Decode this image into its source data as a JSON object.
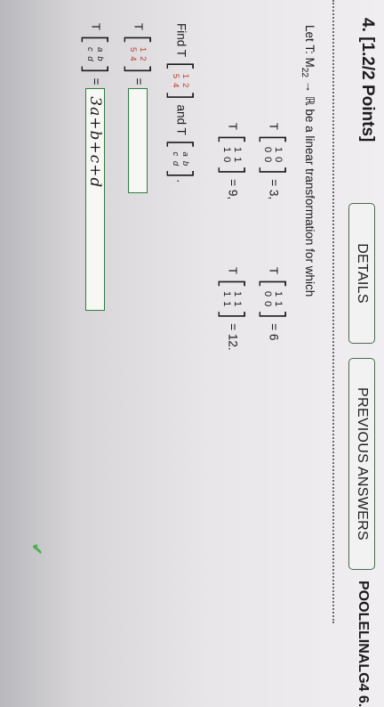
{
  "question": {
    "number_label": "4. [1.2/2 Points]",
    "details_label": "DETAILS",
    "previous_answers_label": "PREVIOUS ANSWERS",
    "course_code": "POOLELINALG4 6."
  },
  "problem": {
    "intro_prefix": "Let T: M",
    "intro_sub": "22",
    "intro_suffix": " → ℝ be a linear transformation for which",
    "T": "T",
    "eq1": {
      "m": [
        "1",
        "0",
        "0",
        "0"
      ],
      "result": "= 3,"
    },
    "eq2": {
      "m": [
        "1",
        "1",
        "0",
        "0"
      ],
      "result": "= 6"
    },
    "eq3": {
      "m": [
        "1",
        "1",
        "1",
        "0"
      ],
      "result": "= 9,"
    },
    "eq4": {
      "m": [
        "1",
        "1",
        "1",
        "1"
      ],
      "result": "= 12."
    },
    "find_label": "Find T",
    "find_m1": [
      "1",
      "2",
      "5",
      "4"
    ],
    "and_label": "and T",
    "find_m2": [
      "a",
      "b",
      "c",
      "d"
    ],
    "period": "."
  },
  "answers": {
    "a1_m": [
      "1",
      "2",
      "5",
      "4"
    ],
    "eq": "=",
    "a1_value": "",
    "a2_m": [
      "a",
      "b",
      "c",
      "d"
    ],
    "a2_value": "3a+b+c+d",
    "a2_status": "correct"
  }
}
